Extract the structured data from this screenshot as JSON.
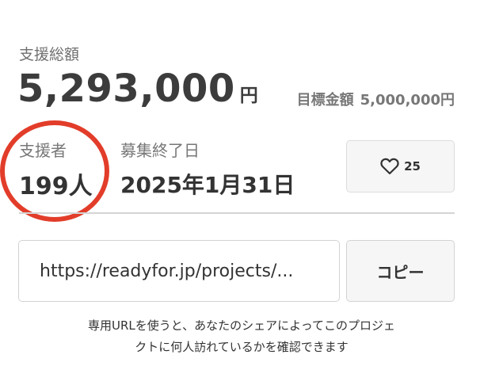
{
  "total": {
    "label": "支援総額",
    "amount": "5,293,000",
    "unit": "円"
  },
  "goal": {
    "label": "目標金額",
    "value": "5,000,000円"
  },
  "supporters": {
    "label": "支援者",
    "value": "199人"
  },
  "end_date": {
    "label": "募集終了日",
    "value": "2025年1月31日"
  },
  "favorite": {
    "icon": "heart-icon",
    "count": "25"
  },
  "share": {
    "url": "https://readyfor.jp/projects/...",
    "copy_label": "コピー",
    "note_line1": "専用URLを使うと、あなたのシェアによってこのプロジェ",
    "note_line2": "クトに何人訪れているかを確認できます"
  },
  "annotation": {
    "color": "#e23d2a"
  }
}
